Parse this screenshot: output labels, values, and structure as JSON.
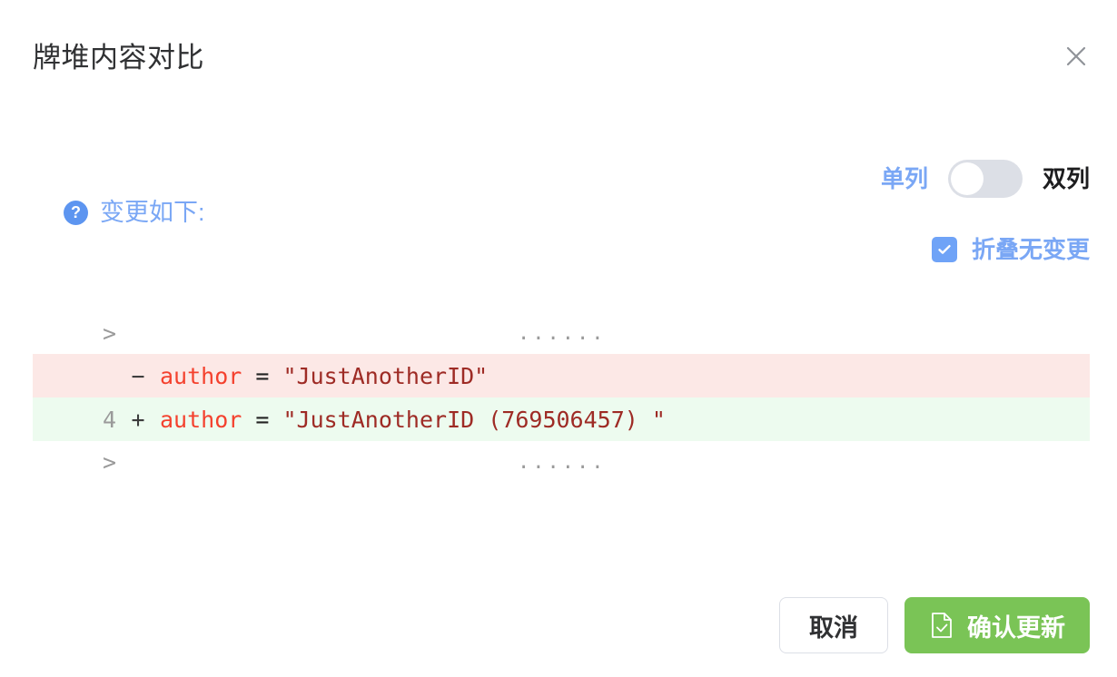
{
  "dialog": {
    "title": "牌堆内容对比",
    "close_icon": "close-icon"
  },
  "options": {
    "column_toggle": {
      "left_label": "单列",
      "right_label": "双列",
      "state": "off",
      "active_side": "left",
      "active_color": "#7AA7F5",
      "track_color": "#DCDFE6"
    },
    "collapse_unchanged": {
      "label": "折叠无变更",
      "checked": true,
      "accent_color": "#6FA3F7"
    },
    "changes_heading": {
      "help_icon": "question-mark-circle-icon",
      "text": "变更如下:",
      "color": "#7AA7F5"
    }
  },
  "diff": {
    "rows": [
      {
        "type": "collapsed",
        "chevron": ">",
        "dots": "......",
        "line_number": "",
        "sign": "",
        "code": ""
      },
      {
        "type": "removed",
        "line_number": "",
        "sign": "−",
        "key": "author",
        "operator": " = ",
        "value": "\"JustAnotherID\"",
        "bg": "#FCE8E6"
      },
      {
        "type": "added",
        "line_number": "4",
        "sign": "+",
        "key": "author",
        "operator": " = ",
        "value": "\"JustAnotherID (769506457) \"",
        "bg": "#EDFBEF"
      },
      {
        "type": "collapsed",
        "chevron": ">",
        "dots": "......",
        "line_number": "",
        "sign": "",
        "code": ""
      }
    ]
  },
  "footer": {
    "cancel_label": "取消",
    "confirm_label": "确认更新",
    "confirm_icon": "document-check-icon",
    "confirm_color": "#7AC456"
  }
}
